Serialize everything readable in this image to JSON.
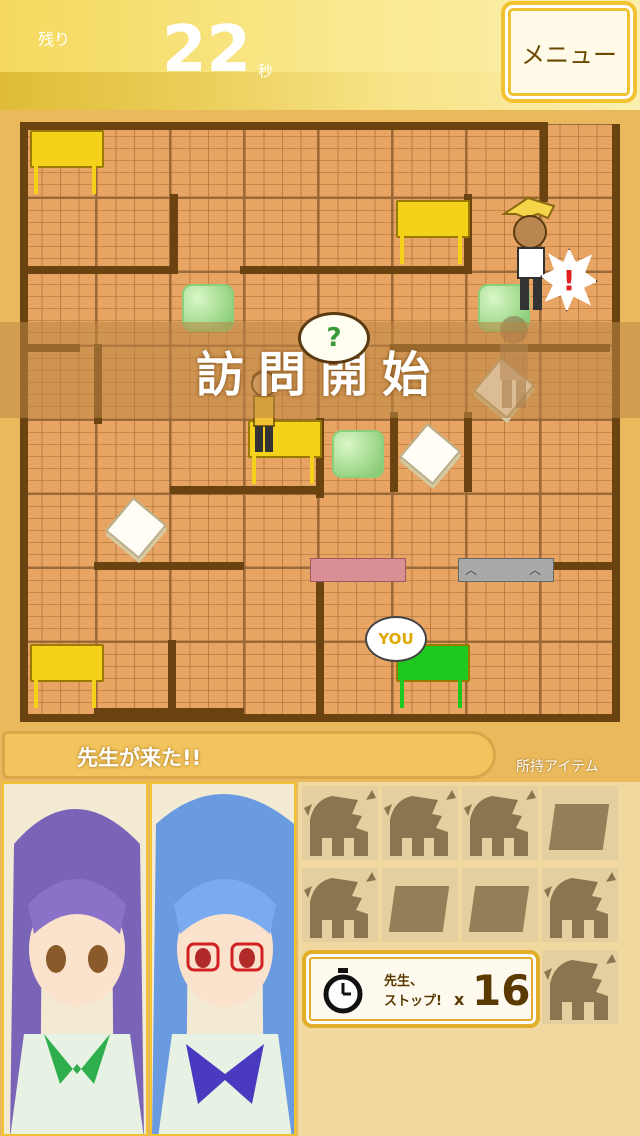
{
  "header": {
    "remaining_label": "残り",
    "remaining_value": "22",
    "remaining_unit": "秒",
    "menu_label": "メニュー"
  },
  "board": {
    "banner_text": "訪問開始",
    "question_mark": "?",
    "you_label": "YOU",
    "alert_mark": "!"
  },
  "message": {
    "text": "先生が来た!!"
  },
  "inventory": {
    "label": "所持アイテム",
    "slots": [
      "tooth-item",
      "tooth-item",
      "tooth-item",
      "block-item",
      "tooth-item",
      "block-item",
      "block-item",
      "tooth-item",
      "tooth-item"
    ]
  },
  "stop_button": {
    "label_line1": "先生、",
    "label_line2": "ストップ!",
    "multiplier": "x",
    "count": "16"
  },
  "colors": {
    "accent": "#f1c232",
    "wall": "#6b4310",
    "floor": "#e7a463",
    "desk_yellow": "#f5d21a",
    "desk_green": "#1fc81f"
  }
}
